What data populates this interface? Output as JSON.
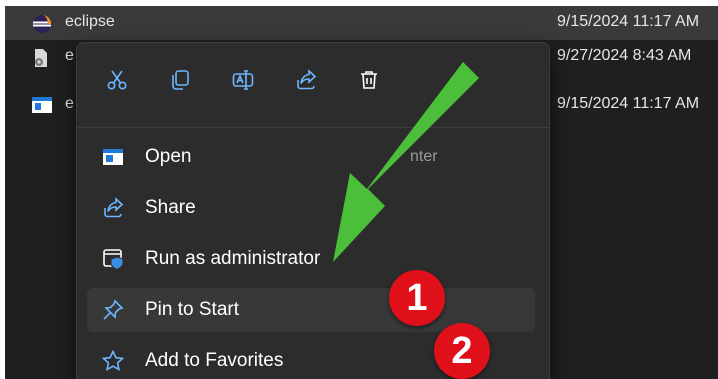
{
  "files": [
    {
      "name": "eclipse",
      "date": "9/15/2024 11:17 AM",
      "selected": true,
      "icon": "eclipse-icon"
    },
    {
      "name": "e",
      "date": "9/27/2024 8:43 AM",
      "selected": false,
      "icon": "settings-file-icon"
    },
    {
      "name": "e",
      "date": "9/15/2024 11:17 AM",
      "selected": false,
      "icon": "app-window-icon"
    }
  ],
  "toolbar": [
    {
      "icon": "cut-icon"
    },
    {
      "icon": "copy-icon"
    },
    {
      "icon": "rename-icon"
    },
    {
      "icon": "share-icon"
    },
    {
      "icon": "delete-icon"
    }
  ],
  "menu": {
    "items": [
      {
        "label": "Open",
        "shortcut": "nter",
        "icon": "open-icon"
      },
      {
        "label": "Share",
        "shortcut": "",
        "icon": "share-icon"
      },
      {
        "label": "Run as administrator",
        "shortcut": "",
        "icon": "shield-icon"
      },
      {
        "label": "Pin to Start",
        "shortcut": "",
        "icon": "pin-icon",
        "highlighted": true
      },
      {
        "label": "Add to Favorites",
        "shortcut": "",
        "icon": "star-icon"
      }
    ]
  },
  "annotations": {
    "badge1": "1",
    "badge2": "2",
    "arrow_color": "#4cbf3a",
    "badge_color": "#e0101b"
  }
}
